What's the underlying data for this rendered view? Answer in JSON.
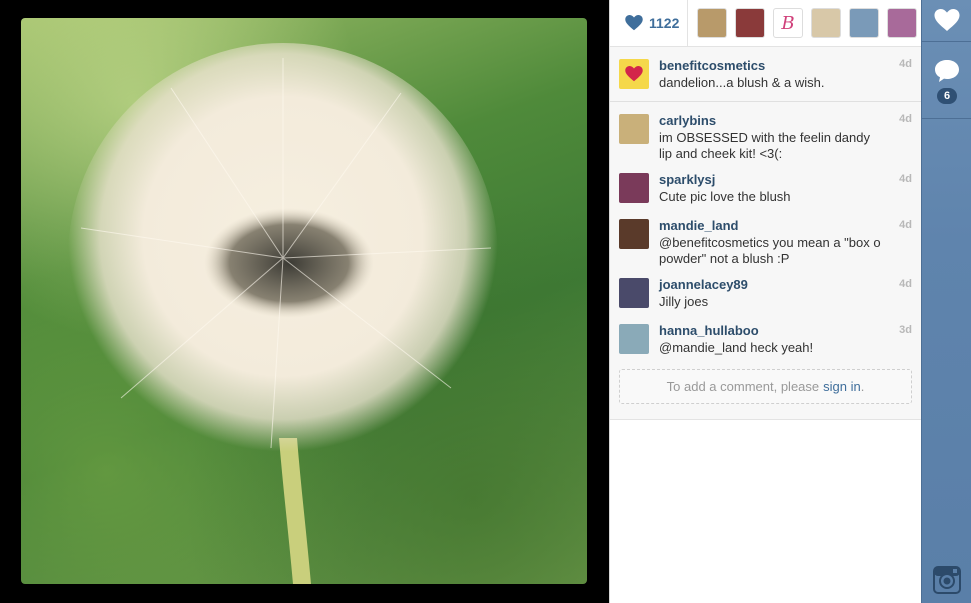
{
  "likes": {
    "count": "1122",
    "icon": "heart-icon"
  },
  "likers": [
    {
      "name": "liker-avatar-1",
      "color": "#b89a6a"
    },
    {
      "name": "liker-avatar-2",
      "color": "#8a3a3a"
    },
    {
      "name": "liker-avatar-3",
      "color": "#ffffff",
      "glyph": "B"
    },
    {
      "name": "liker-avatar-4",
      "color": "#d8c8a8"
    },
    {
      "name": "liker-avatar-5",
      "color": "#7a9ab8"
    },
    {
      "name": "liker-avatar-6",
      "color": "#a86a9a"
    }
  ],
  "caption": {
    "user": "benefitcosmetics",
    "text": "dandelion...a blush & a wish.",
    "time": "4d"
  },
  "comments": [
    {
      "user": "carlybins",
      "text": "im OBSESSED with the feelin dandy lip and cheek kit! <3(:",
      "time": "4d",
      "color": "#c9b07a"
    },
    {
      "user": "sparklysj",
      "text": "Cute pic love the blush",
      "time": "4d",
      "color": "#7a3a5a"
    },
    {
      "user": "mandie_land",
      "text": "@benefitcosmetics you mean a \"box o powder\" not a blush :P",
      "time": "4d",
      "color": "#5a3a2a"
    },
    {
      "user": "joannelacey89",
      "text": "Jilly joes",
      "time": "4d",
      "color": "#4a4a6a"
    },
    {
      "user": "hanna_hullaboo",
      "text": "@mandie_land heck yeah!",
      "time": "3d",
      "color": "#8aaab8"
    }
  ],
  "add_comment": {
    "prefix": "To add a comment, please",
    "link": "sign in",
    "suffix": "."
  },
  "rail": {
    "comment_count": "6"
  },
  "colors": {
    "accent": "#3f6e9b",
    "rail": "#6b8fb5"
  }
}
